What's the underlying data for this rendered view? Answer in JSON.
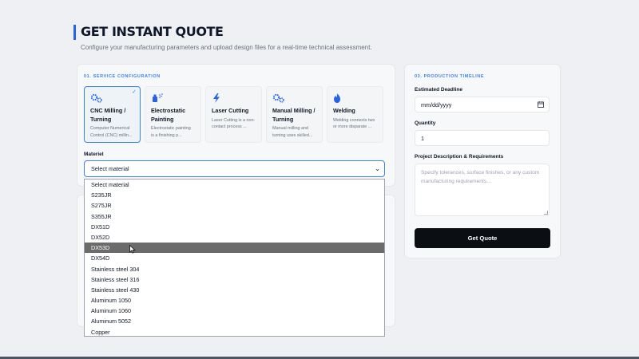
{
  "header": {
    "title": "GET INSTANT QUOTE",
    "subtitle": "Configure your manufacturing parameters and upload design files for a real-time technical assessment."
  },
  "service_configuration": {
    "label": "01. SERVICE CONFIGURATION",
    "services": [
      {
        "title": "CNC Milling / Turning",
        "desc": "Computer Numerical Control (CNC) millin...",
        "icon": "gears-icon",
        "selected": true
      },
      {
        "title": "Electrostatic Painting",
        "desc": "Electrostatic painting is a finishing p...",
        "icon": "spray-gun-icon",
        "selected": false
      },
      {
        "title": "Laser Cutting",
        "desc": "Laser Cutting is a non-contact process ...",
        "icon": "lightning-icon",
        "selected": false
      },
      {
        "title": "Manual Milling / Turning",
        "desc": "Manual milling and turning uses skilled...",
        "icon": "gears-icon",
        "selected": false
      },
      {
        "title": "Welding",
        "desc": "Welding connects two or more disparate ...",
        "icon": "flame-icon",
        "selected": false
      }
    ],
    "material_label": "Materiel",
    "material_selected": "Select material",
    "material_options": [
      "Select material",
      "S235JR",
      "S275JR",
      "S355JR",
      "DX51D",
      "DX52D",
      "DX53D",
      "DX54D",
      "Stainless steel 304",
      "Stainless steel 316",
      "Stainless steel 430",
      "Aluminum 1050",
      "Aluminum 1060",
      "Aluminum 5052",
      "Copper"
    ],
    "highlighted_option": "DX53D"
  },
  "production_timeline": {
    "label": "03. PRODUCTION TIMELINE",
    "deadline_label": "Estimated Deadline",
    "deadline_placeholder": "mm/dd/yyyy",
    "quantity_label": "Quantity",
    "quantity_value": "1",
    "description_label": "Project Description & Requirements",
    "description_placeholder": "Specify tolerances, surface finishes, or any custom manufacturing requirements...",
    "submit_label": "Get Quote"
  },
  "colors": {
    "accent": "#3b82f6",
    "button": "#0b0f14",
    "highlight": "#6b6b6b"
  }
}
